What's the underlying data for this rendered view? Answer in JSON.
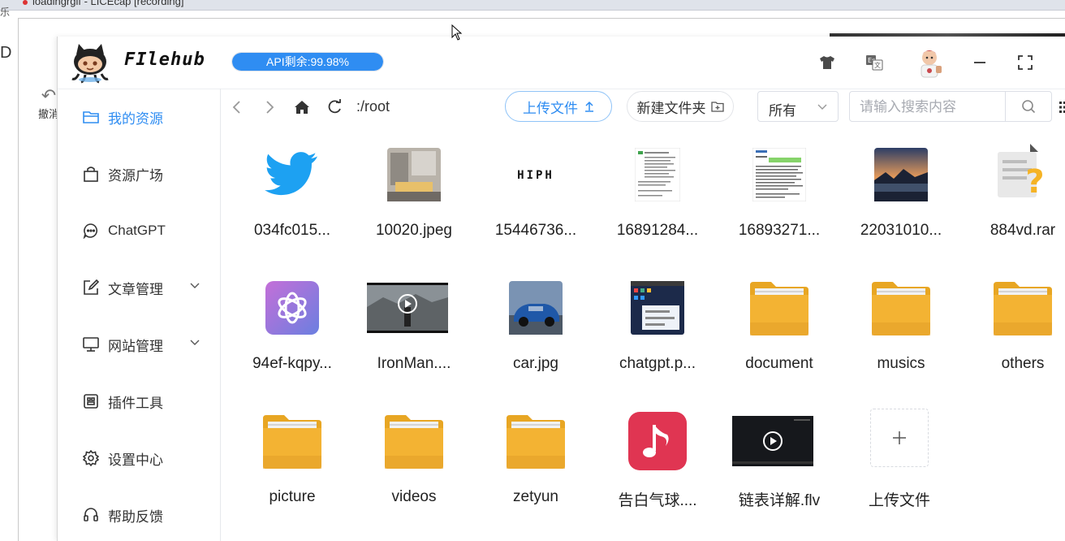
{
  "background": {
    "recording_title": "loadingrgif - LICEcap [recording]",
    "left_char_top": "乐",
    "left_char_mid": "D",
    "undo_label": "撤消"
  },
  "app": {
    "brand": "FIlehub",
    "api_usage": {
      "label": "API剩余:99.98%",
      "remaining_fraction": 0.9998
    },
    "header_icons": [
      "tshirt-icon",
      "translate-icon",
      "avatar",
      "minimize-icon",
      "fullscreen-icon"
    ],
    "sidebar": {
      "items": [
        {
          "label": "我的资源",
          "icon": "folder-icon",
          "active": true
        },
        {
          "label": "资源广场",
          "icon": "shopping-bag-icon"
        },
        {
          "label": "ChatGPT",
          "icon": "chat-bubble-icon"
        },
        {
          "label": "文章管理",
          "icon": "edit-icon",
          "expandable": true
        },
        {
          "label": "网站管理",
          "icon": "monitor-icon",
          "expandable": true
        },
        {
          "label": "插件工具",
          "icon": "plugin-icon"
        },
        {
          "label": "设置中心",
          "icon": "gear-icon"
        },
        {
          "label": "帮助反馈",
          "icon": "headset-icon"
        }
      ]
    },
    "toolbar": {
      "path": ":/root",
      "upload_label": "上传文件",
      "new_folder_label": "新建文件夹",
      "filter_value": "所有",
      "search_placeholder": "请输入搜索内容"
    },
    "files": [
      {
        "name": "034fc015...",
        "kind": "twitter-logo"
      },
      {
        "name": "10020.jpeg",
        "kind": "photo-room"
      },
      {
        "name": "15446736...",
        "kind": "text-logo",
        "logo_text": "HIPH"
      },
      {
        "name": "16891284...",
        "kind": "doc-screenshot"
      },
      {
        "name": "16893271...",
        "kind": "doc-screenshot-green"
      },
      {
        "name": "22031010...",
        "kind": "photo-lake"
      },
      {
        "name": "884vd.rar",
        "kind": "unknown-file"
      },
      {
        "name": "94ef-kqpy...",
        "kind": "openai-logo"
      },
      {
        "name": "IronMan....",
        "kind": "video-thumb"
      },
      {
        "name": "car.jpg",
        "kind": "photo-car"
      },
      {
        "name": "chatgpt.p...",
        "kind": "desktop-screenshot"
      },
      {
        "name": "document",
        "kind": "folder"
      },
      {
        "name": "musics",
        "kind": "folder"
      },
      {
        "name": "others",
        "kind": "folder"
      },
      {
        "name": "picture",
        "kind": "folder"
      },
      {
        "name": "videos",
        "kind": "folder"
      },
      {
        "name": "zetyun",
        "kind": "folder"
      },
      {
        "name": "告白气球....",
        "kind": "music-file"
      },
      {
        "name": "链表详解.flv",
        "kind": "video-dark"
      }
    ],
    "upload_tile_label": "上传文件",
    "colors": {
      "accent": "#2f8df2",
      "folder": "#f0b030",
      "music": "#e03552"
    }
  }
}
